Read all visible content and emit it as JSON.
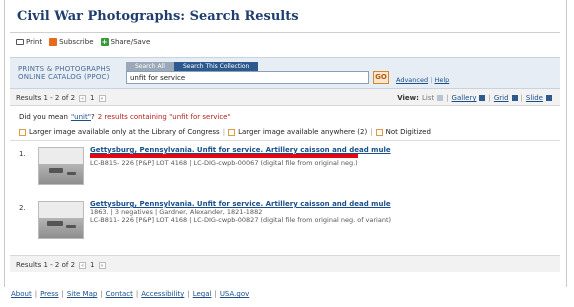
{
  "page": {
    "title": "Civil War Photographs: Search Results"
  },
  "share": {
    "print": "Print",
    "subscribe": "Subscribe",
    "share_save": "Share/Save"
  },
  "search": {
    "catalog_name_line1": "PRINTS & PHOTOGRAPHS",
    "catalog_name_line2": "ONLINE CATALOG (PPOC)",
    "tab_all": "Search All",
    "tab_collection": "Search This Collection",
    "query": "unfit for service",
    "go": "GO",
    "advanced": "Advanced",
    "help": "Help"
  },
  "results_bar": {
    "count": "Results 1 - 2 of 2",
    "prev": "«",
    "page": "1",
    "next": "»",
    "view_label": "View:",
    "views": [
      "List",
      "Gallery",
      "Grid",
      "Slide"
    ]
  },
  "suggestion": {
    "prefix": "Did you mean",
    "term": "\"unit\"",
    "suffix": "?",
    "hint": "2 results containing \"unfit for service\""
  },
  "filters": [
    "Larger image available only at the Library of Congress",
    "Larger image available anywhere (2)",
    "Not Digitized"
  ],
  "results": [
    {
      "num": "1.",
      "title": "Gettysburg, Pennsylvania. Unfit for service. Artillery caisson and dead mule",
      "meta": [
        "LC-B815- 226 [P&P] LOT 4168 | LC-DIG-cwpb-00067 (digital file from original neg.)"
      ]
    },
    {
      "num": "2.",
      "title": "Gettysburg, Pennsylvania. Unfit for service. Artillery caisson and dead mule",
      "meta": [
        "1863. | 3 negatives | Gardner, Alexander, 1821-1882",
        "LC-B811- 226 [P&P] LOT 4168 | LC-DIG-cwpb-00827 (digital file from original neg. of variant)"
      ]
    }
  ],
  "footer": [
    "About",
    "Press",
    "Site Map",
    "Contact",
    "Accessibility",
    "Legal",
    "USA.gov"
  ],
  "colors": {
    "title": "#1f3e6e",
    "link": "#1a4f8b",
    "highlight": "#e30613",
    "accent": "#e39a3c"
  }
}
